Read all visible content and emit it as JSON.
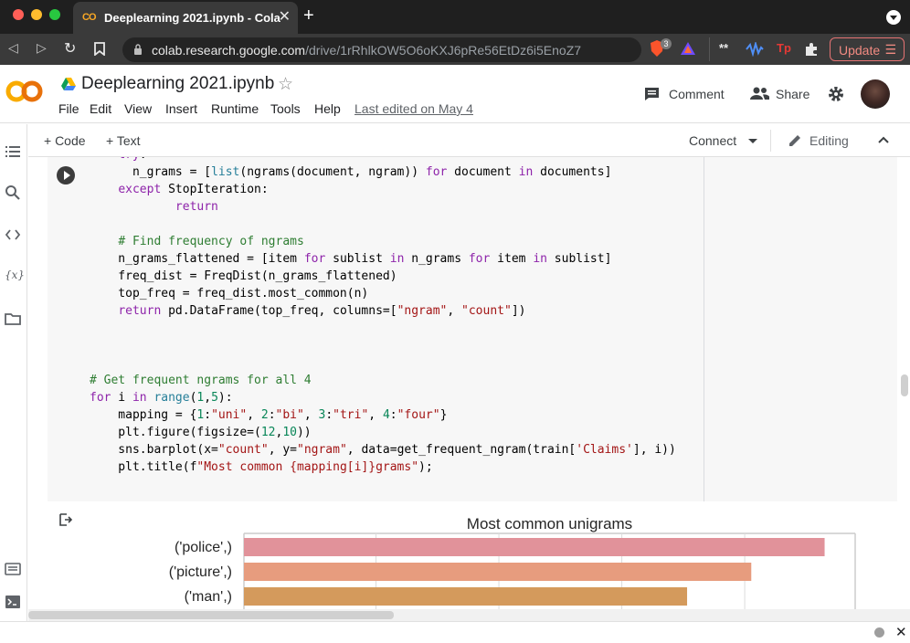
{
  "browser": {
    "tab_title": "Deeplearning 2021.ipynb - Cola",
    "tab_logo": "CO",
    "tab_close": "✕",
    "new_tab": "+",
    "url_host": "colab.research.google.com",
    "url_path": "/drive/1rRhlkOW5O6oKXJ6pRe56EtDz6i5EnoZ7",
    "brave_badge": "3",
    "update_label": "Update",
    "ext_icons": [
      "**",
      "wave-icon",
      "Tp",
      "puzzle-icon"
    ]
  },
  "notebook": {
    "title": "Deeplearning 2021.ipynb",
    "menu": [
      "File",
      "Edit",
      "View",
      "Insert",
      "Runtime",
      "Tools",
      "Help"
    ],
    "last_edited": "Last edited on May 4",
    "comment_label": "Comment",
    "share_label": "Share"
  },
  "cell_toolbar": {
    "add_code": "+ Code",
    "add_text": "+ Text",
    "connect": "Connect",
    "editing": "Editing"
  },
  "code_lines": [
    "    try:",
    "      n_grams = [list(ngrams(document, ngram)) for document in documents]",
    "    except StopIteration:",
    "            return",
    "",
    "    # Find frequency of ngrams",
    "    n_grams_flattened = [item for sublist in n_grams for item in sublist]",
    "    freq_dist = FreqDist(n_grams_flattened)",
    "    top_freq = freq_dist.most_common(n)",
    "    return pd.DataFrame(top_freq, columns=[\"ngram\", \"count\"])",
    "",
    "",
    "",
    "# Get frequent ngrams for all 4",
    "for i in range(1,5):",
    "    mapping = {1:\"uni\", 2:\"bi\", 3:\"tri\", 4:\"four\"}",
    "    plt.figure(figsize=(12,10))",
    "    sns.barplot(x=\"count\", y=\"ngram\", data=get_frequent_ngram(train['Claims'], i))",
    "    plt.title(f\"Most common {mapping[i]}grams\");"
  ],
  "chart_data": {
    "type": "bar",
    "orientation": "horizontal",
    "title": "Most common unigrams",
    "categories": [
      "('police',)",
      "('picture',)",
      "('man',)"
    ],
    "values": [
      0.95,
      0.83,
      0.725
    ],
    "xlim": [
      0,
      1
    ],
    "colors": [
      "#e1929a",
      "#e79c7e",
      "#d49a5c"
    ],
    "grid": true,
    "note": "values are relative (axis ticks not visible in view)"
  },
  "colors": {
    "accent_orange": "#f9ab00",
    "brand_yellow": "#f9a825"
  }
}
